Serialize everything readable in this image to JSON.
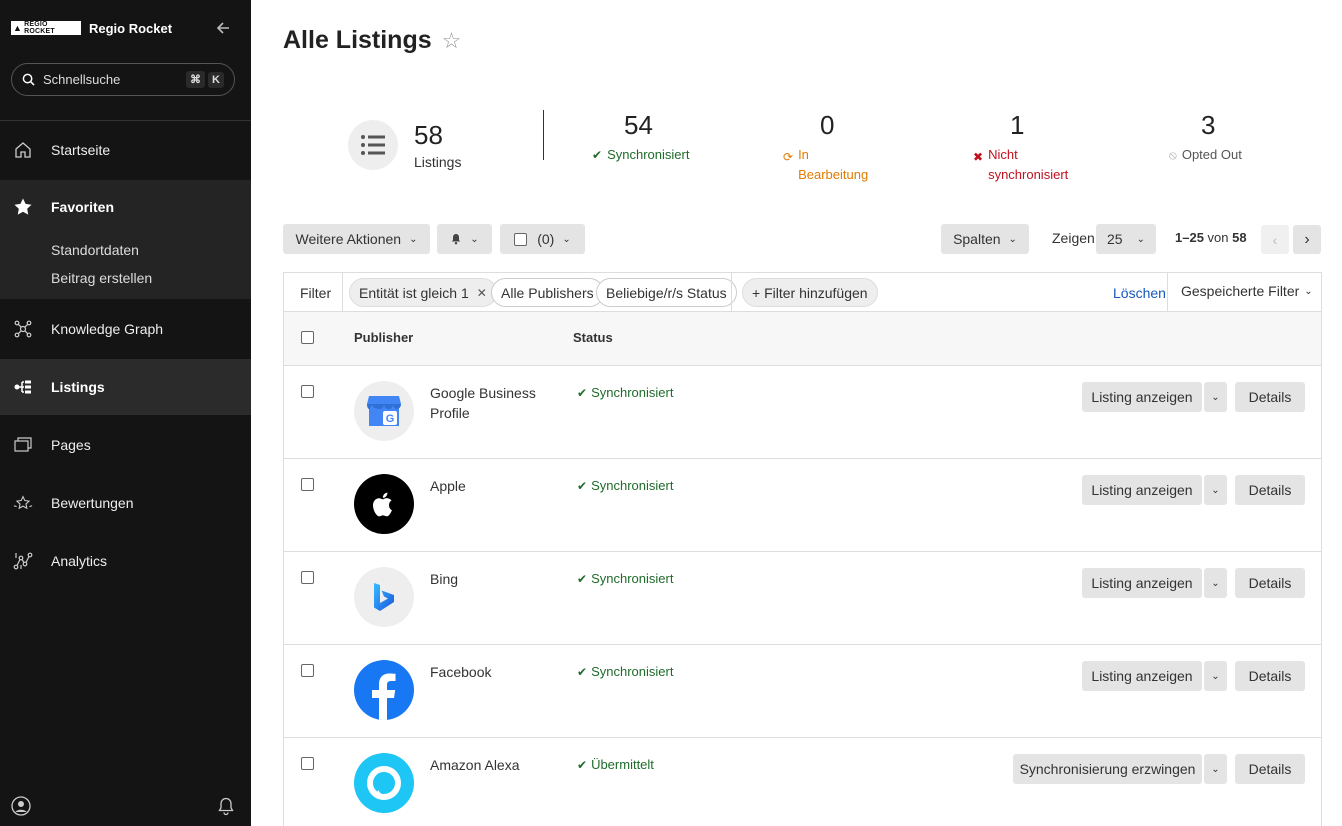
{
  "sidebar": {
    "brand_logo_text": "REGIO ROCKET",
    "brand_name": "Regio Rocket",
    "search_placeholder": "Schnellsuche",
    "shortcut_key1": "⌘",
    "shortcut_key2": "K",
    "nav": [
      {
        "label": "Startseite",
        "icon": "home-icon"
      },
      {
        "label": "Favoriten",
        "icon": "star-icon"
      },
      {
        "label": "Knowledge Graph",
        "icon": "graph-icon"
      },
      {
        "label": "Listings",
        "icon": "listings-icon"
      },
      {
        "label": "Pages",
        "icon": "pages-icon"
      },
      {
        "label": "Bewertungen",
        "icon": "reviews-icon"
      },
      {
        "label": "Analytics",
        "icon": "analytics-icon"
      }
    ],
    "favorites": [
      "Standortdaten",
      "Beitrag erstellen"
    ]
  },
  "header": {
    "title": "Alle Listings"
  },
  "stats": {
    "total": {
      "value": "58",
      "label": "Listings"
    },
    "synced": {
      "value": "54",
      "label": "Synchronisiert",
      "color": "#1f6b2a"
    },
    "processing": {
      "value": "0",
      "label_line1": "In",
      "label_line2": "Bearbeitung",
      "color": "#e07b00"
    },
    "not_synced": {
      "value": "1",
      "label_line1": "Nicht",
      "label_line2": "synchronisiert",
      "color": "#c0101e"
    },
    "opted_out": {
      "value": "3",
      "label": "Opted Out",
      "color": "#555555"
    }
  },
  "toolbar": {
    "more_actions": "Weitere Aktionen",
    "selected_count": "(0)",
    "columns": "Spalten",
    "show_label": "Zeigen",
    "page_size": "25",
    "range": "1–25",
    "of": "von",
    "total": "58"
  },
  "filters": {
    "label": "Filter",
    "chips": [
      "Entität ist gleich 1",
      "Alle Publishers",
      "Beliebige/r/s Status"
    ],
    "add": "+ Filter hinzufügen",
    "clear": "Löschen",
    "saved": "Gespeicherte Filter"
  },
  "table": {
    "col_publisher": "Publisher",
    "col_status": "Status",
    "rows": [
      {
        "publisher": "Google Business Profile",
        "status": "Synchronisiert",
        "action": "Listing anzeigen",
        "details": "Details",
        "logo": "google-business-icon"
      },
      {
        "publisher": "Apple",
        "status": "Synchronisiert",
        "action": "Listing anzeigen",
        "details": "Details",
        "logo": "apple-icon"
      },
      {
        "publisher": "Bing",
        "status": "Synchronisiert",
        "action": "Listing anzeigen",
        "details": "Details",
        "logo": "bing-icon"
      },
      {
        "publisher": "Facebook",
        "status": "Synchronisiert",
        "action": "Listing anzeigen",
        "details": "Details",
        "logo": "facebook-icon"
      },
      {
        "publisher": "Amazon Alexa",
        "status": "Übermittelt",
        "action": "Synchronisierung erzwingen",
        "details": "Details",
        "logo": "alexa-icon"
      }
    ]
  },
  "colors": {
    "sidebar_bg": "#141414",
    "link": "#1558c0",
    "success": "#1f6b2a"
  }
}
